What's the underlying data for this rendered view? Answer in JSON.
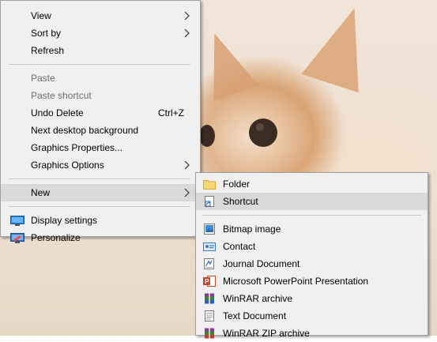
{
  "menu": {
    "items": [
      {
        "label": "View"
      },
      {
        "label": "Sort by"
      },
      {
        "label": "Refresh"
      },
      {
        "label": "Paste"
      },
      {
        "label": "Paste shortcut"
      },
      {
        "label": "Undo Delete",
        "shortcut": "Ctrl+Z"
      },
      {
        "label": "Next desktop background"
      },
      {
        "label": "Graphics Properties..."
      },
      {
        "label": "Graphics Options"
      },
      {
        "label": "New"
      },
      {
        "label": "Display settings"
      },
      {
        "label": "Personalize"
      }
    ]
  },
  "submenu": {
    "items": [
      {
        "label": "Folder"
      },
      {
        "label": "Shortcut"
      },
      {
        "label": "Bitmap image"
      },
      {
        "label": "Contact"
      },
      {
        "label": "Journal Document"
      },
      {
        "label": "Microsoft PowerPoint Presentation"
      },
      {
        "label": "WinRAR archive"
      },
      {
        "label": "Text Document"
      },
      {
        "label": "WinRAR ZIP archive"
      }
    ]
  },
  "colors": {
    "menu_bg": "#f0f0f0",
    "highlight": "#d9d9d9",
    "disabled_text": "#6d6d6d",
    "folder_yellow": "#f8d775",
    "powerpoint_red": "#c8472c"
  },
  "icons": {
    "display_settings": "monitor-icon",
    "personalize": "personalize-icon",
    "folder": "folder-icon",
    "shortcut": "shortcut-icon",
    "bitmap": "bitmap-icon",
    "contact": "contact-icon",
    "journal": "journal-icon",
    "powerpoint": "powerpoint-icon",
    "winrar": "winrar-icon",
    "text": "text-document-icon",
    "winrar_zip": "winrar-zip-icon"
  }
}
